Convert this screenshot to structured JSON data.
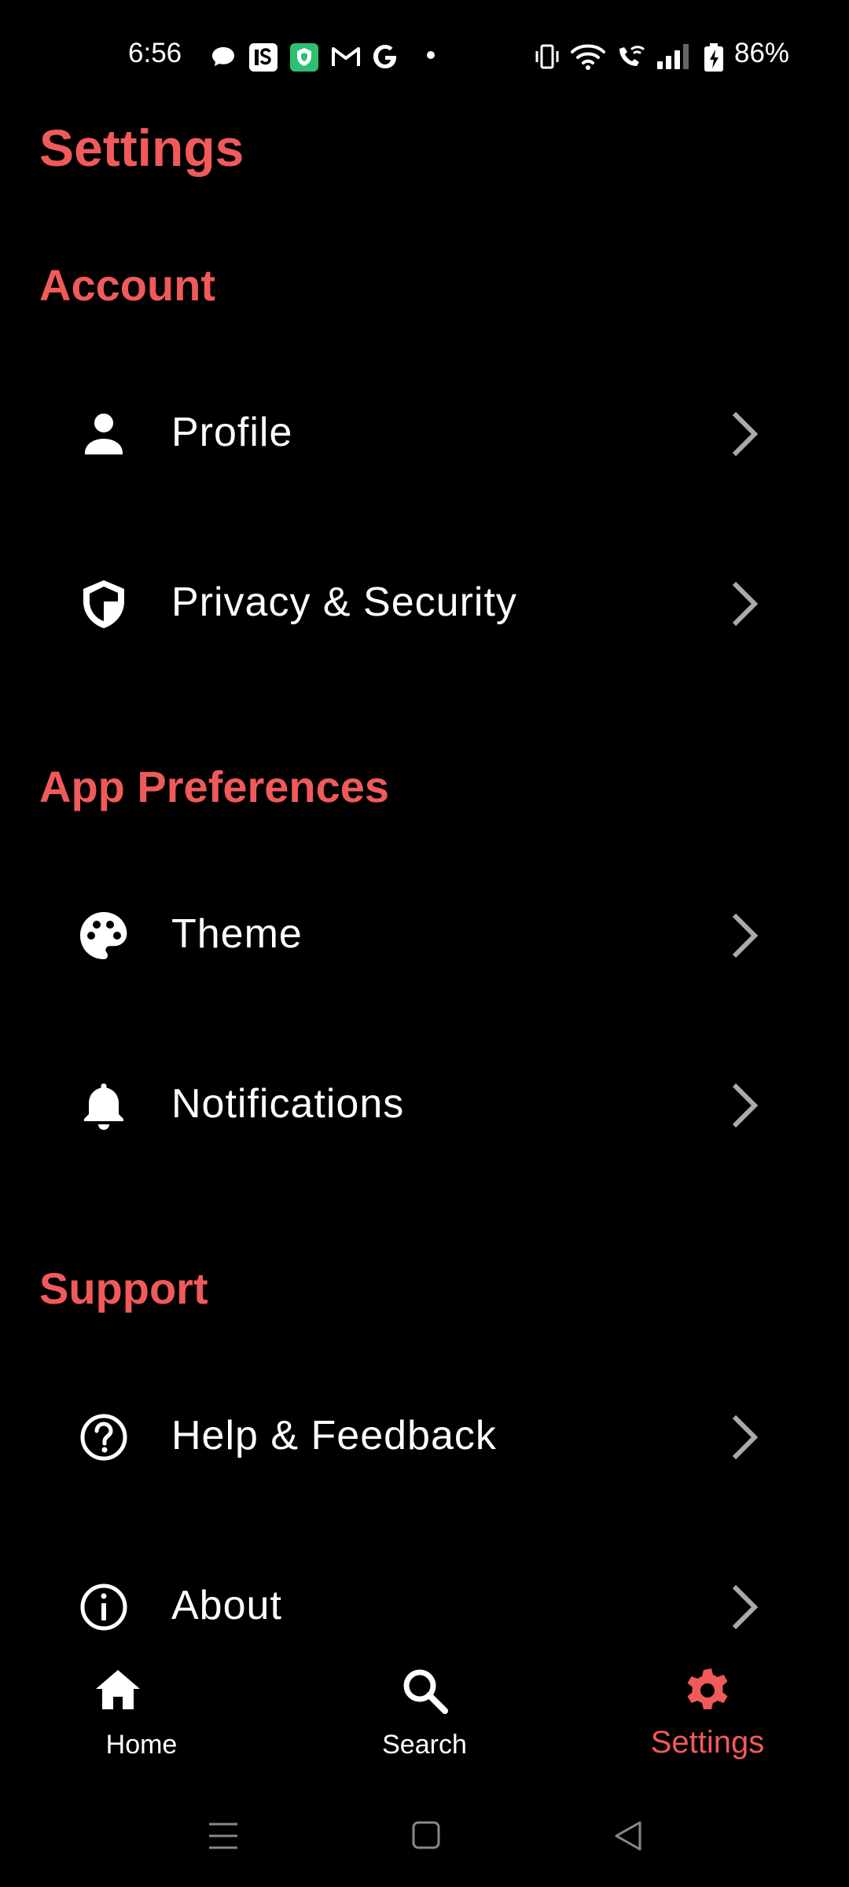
{
  "status_bar": {
    "time": "6:56",
    "battery_percent": "86%",
    "icons": [
      "chat-icon",
      "is-app-icon",
      "shield-app-icon",
      "gmail-icon",
      "google-icon",
      "dot-icon",
      "vibrate-icon",
      "wifi-icon",
      "wifi-call-icon",
      "signal-icon",
      "battery-charging-icon"
    ]
  },
  "page": {
    "title": "Settings",
    "accent_color": "#f05a5a"
  },
  "sections": {
    "account": {
      "title": "Account",
      "items": [
        {
          "label": "Profile",
          "icon": "person-icon"
        },
        {
          "label": "Privacy & Security",
          "icon": "shield-icon"
        }
      ]
    },
    "app_preferences": {
      "title": "App Preferences",
      "items": [
        {
          "label": "Theme",
          "icon": "palette-icon"
        },
        {
          "label": "Notifications",
          "icon": "bell-icon"
        }
      ]
    },
    "support": {
      "title": "Support",
      "items": [
        {
          "label": "Help & Feedback",
          "icon": "help-circle-icon"
        },
        {
          "label": "About",
          "icon": "info-circle-icon"
        }
      ]
    }
  },
  "bottom_nav": {
    "items": [
      {
        "label": "Home",
        "icon": "home-icon",
        "active": false
      },
      {
        "label": "Search",
        "icon": "search-icon",
        "active": false
      },
      {
        "label": "Settings",
        "icon": "gear-icon",
        "active": true
      }
    ]
  },
  "system_nav": {
    "buttons": [
      "recents-icon",
      "home-button-icon",
      "back-icon"
    ]
  }
}
